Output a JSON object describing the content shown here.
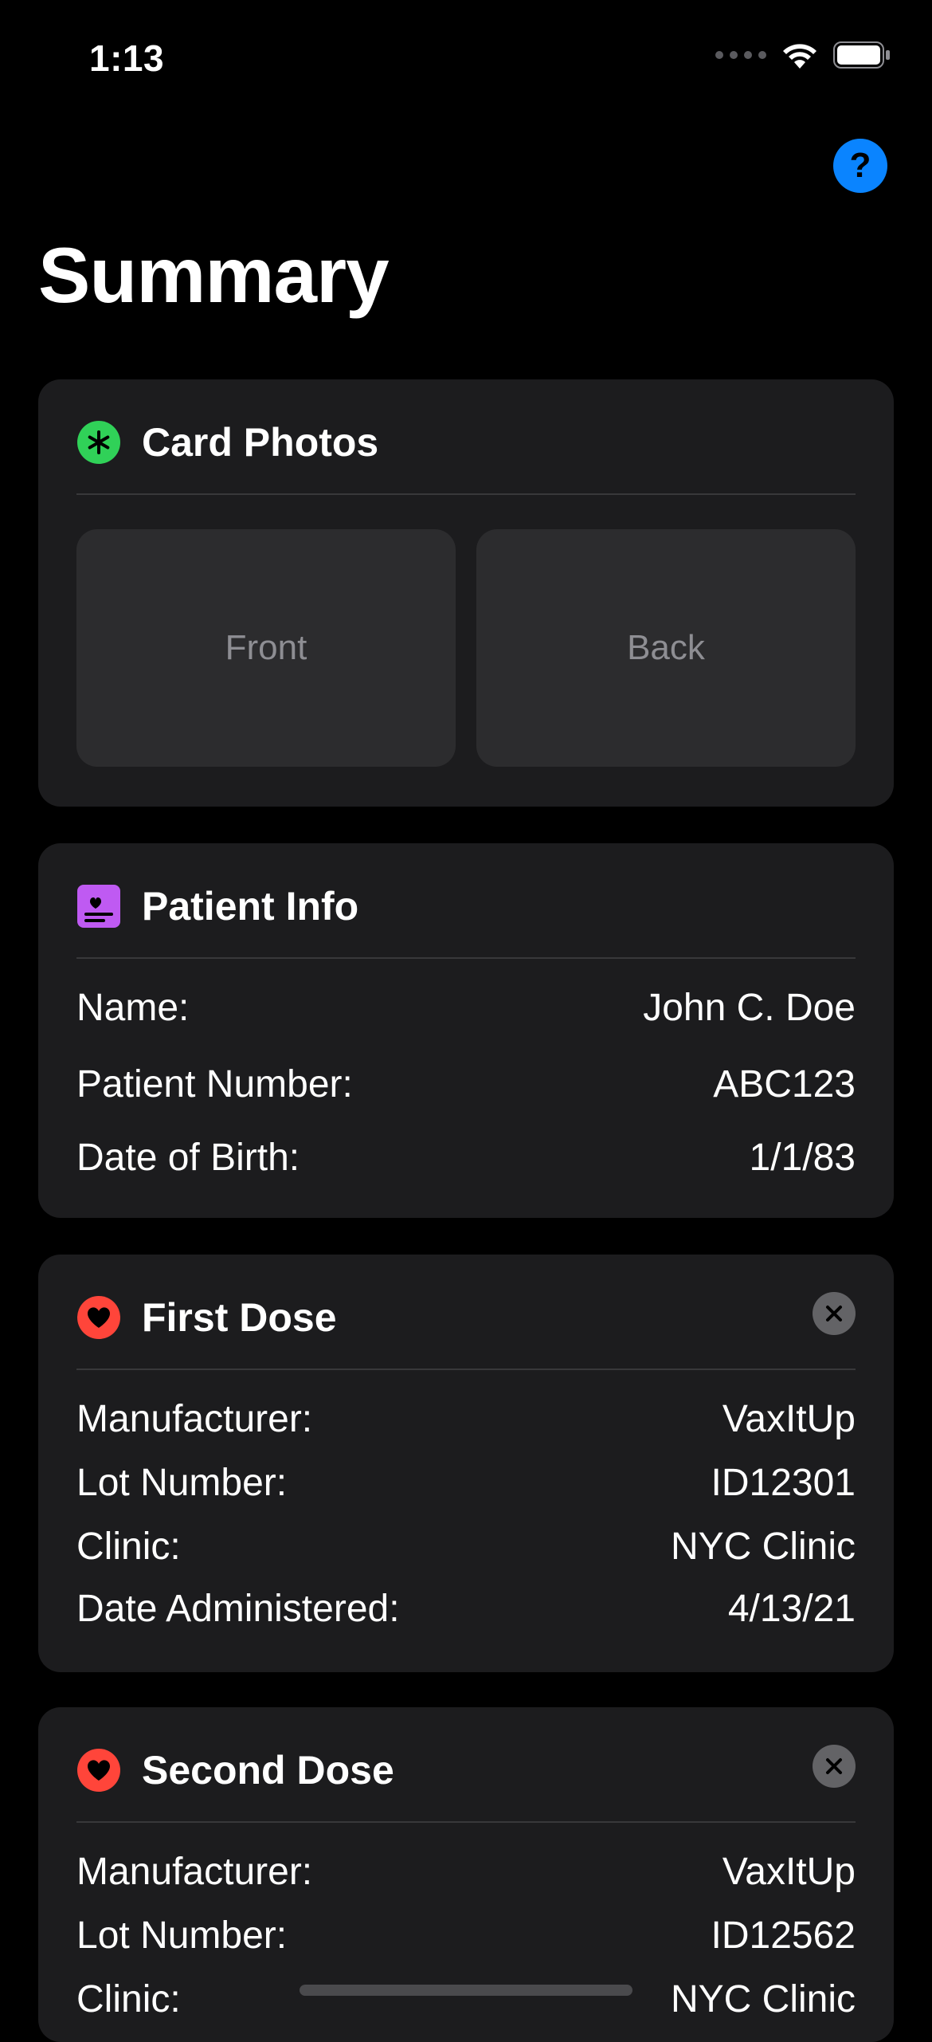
{
  "status_bar": {
    "time": "1:13"
  },
  "header": {
    "title": "Summary",
    "help_label": "?"
  },
  "card_photos": {
    "title": "Card Photos",
    "front_label": "Front",
    "back_label": "Back"
  },
  "patient_info": {
    "title": "Patient Info",
    "rows": [
      {
        "label": "Name:",
        "value": "John C. Doe"
      },
      {
        "label": "Patient Number:",
        "value": "ABC123"
      },
      {
        "label": "Date of Birth:",
        "value": "1/1/83"
      }
    ]
  },
  "first_dose": {
    "title": "First Dose",
    "rows": [
      {
        "label": "Manufacturer:",
        "value": "VaxItUp"
      },
      {
        "label": "Lot Number:",
        "value": "ID12301"
      },
      {
        "label": "Clinic:",
        "value": "NYC Clinic"
      },
      {
        "label": "Date Administered:",
        "value": "4/13/21"
      }
    ]
  },
  "second_dose": {
    "title": "Second Dose",
    "rows": [
      {
        "label": "Manufacturer:",
        "value": "VaxItUp"
      },
      {
        "label": "Lot Number:",
        "value": "ID12562"
      },
      {
        "label": "Clinic:",
        "value": "NYC Clinic"
      }
    ]
  },
  "colors": {
    "background": "#000000",
    "card": "#1c1c1e",
    "accent_blue": "#0a84ff",
    "photos_icon_green": "#30d158",
    "patient_icon_purple": "#bf5af2",
    "dose_icon_red": "#ff453a"
  },
  "icons": {
    "card_photos": "asterisk-icon",
    "patient_info": "id-card-icon",
    "dose": "heart-icon",
    "remove": "close-icon",
    "help": "question-icon"
  }
}
